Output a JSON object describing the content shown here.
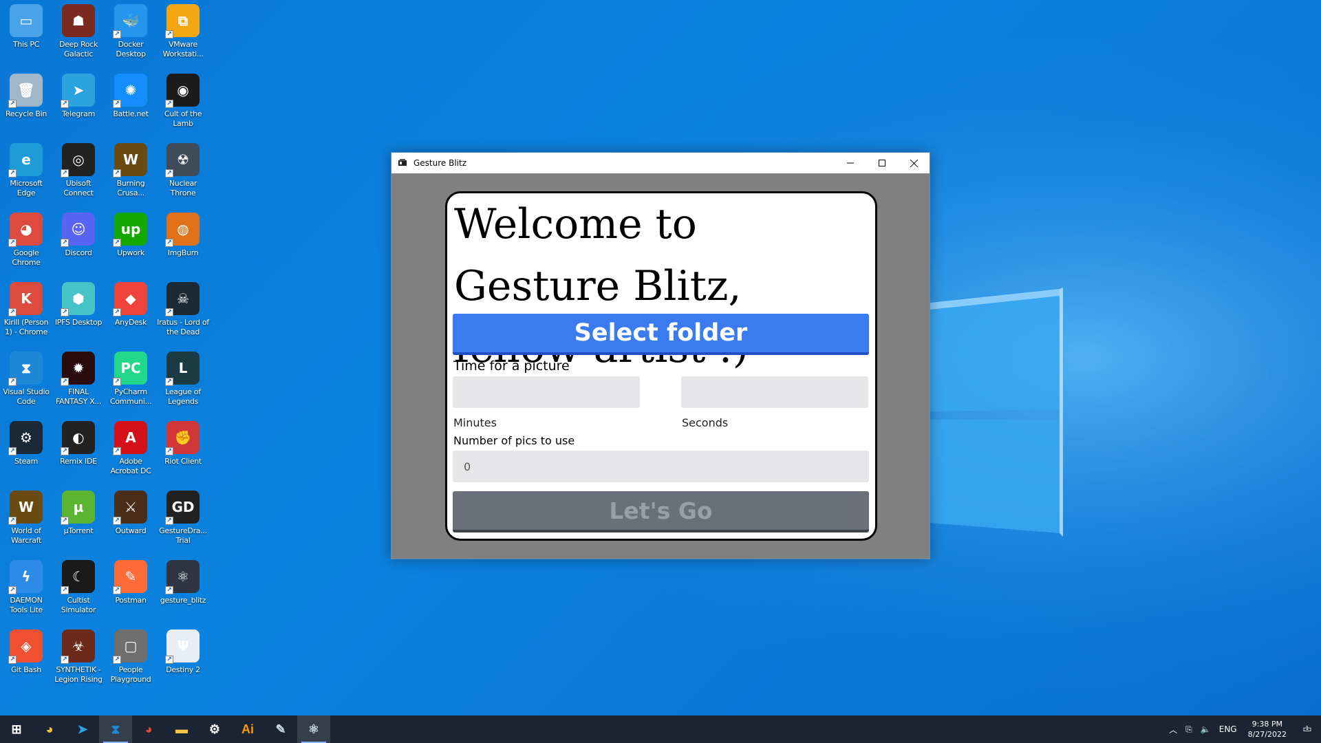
{
  "desktop": {
    "icons": [
      {
        "label": "This PC",
        "icon": "pc-icon",
        "color": "#4aa3e8",
        "glyph": "▭"
      },
      {
        "label": "Deep Rock Galactic",
        "icon": "deep-rock-icon",
        "color": "#7a2a20",
        "glyph": "☗"
      },
      {
        "label": "Docker Desktop",
        "icon": "docker-icon",
        "color": "#2496ed",
        "glyph": "🐳"
      },
      {
        "label": "VMware Workstati...",
        "icon": "vmware-icon",
        "color": "#f3a712",
        "glyph": "⧉"
      },
      {
        "label": "Recycle Bin",
        "icon": "recycle-bin-icon",
        "color": "#9fb7c9",
        "glyph": "🗑"
      },
      {
        "label": "Telegram",
        "icon": "telegram-icon",
        "color": "#2aa3df",
        "glyph": "➤"
      },
      {
        "label": "Battle.net",
        "icon": "battlenet-icon",
        "color": "#148eff",
        "glyph": "✺"
      },
      {
        "label": "Cult of the Lamb",
        "icon": "cult-of-the-lamb-icon",
        "color": "#1b1b1b",
        "glyph": "◉"
      },
      {
        "label": "Microsoft Edge",
        "icon": "edge-icon",
        "color": "#1d9bd7",
        "glyph": "e"
      },
      {
        "label": "Ubisoft Connect",
        "icon": "ubisoft-icon",
        "color": "#222222",
        "glyph": "◎"
      },
      {
        "label": "Burning Crusa...",
        "icon": "wow-burning-crusade-icon",
        "color": "#6a4b12",
        "glyph": "W"
      },
      {
        "label": "Nuclear Throne",
        "icon": "nuclear-throne-icon",
        "color": "#3f4a5a",
        "glyph": "☢"
      },
      {
        "label": "Google Chrome",
        "icon": "chrome-icon",
        "color": "#dd4b3e",
        "glyph": "◕"
      },
      {
        "label": "Discord",
        "icon": "discord-icon",
        "color": "#5865f2",
        "glyph": "☺"
      },
      {
        "label": "Upwork",
        "icon": "upwork-icon",
        "color": "#14a800",
        "glyph": "up"
      },
      {
        "label": "ImgBurn",
        "icon": "imgburn-icon",
        "color": "#e0701a",
        "glyph": "◍"
      },
      {
        "label": "Kirill (Person 1) - Chrome",
        "icon": "chrome-profile-icon",
        "color": "#dd4b3e",
        "glyph": "K"
      },
      {
        "label": "IPFS Desktop",
        "icon": "ipfs-icon",
        "color": "#46c3c6",
        "glyph": "⬢"
      },
      {
        "label": "AnyDesk",
        "icon": "anydesk-icon",
        "color": "#ef443b",
        "glyph": "◆"
      },
      {
        "label": "Iratus - Lord of the Dead",
        "icon": "iratus-icon",
        "color": "#1e2a33",
        "glyph": "☠"
      },
      {
        "label": "Visual Studio Code",
        "icon": "vscode-icon",
        "color": "#1e88d8",
        "glyph": "⧗"
      },
      {
        "label": "FINAL FANTASY X...",
        "icon": "ffxiv-icon",
        "color": "#2a0c0c",
        "glyph": "✹"
      },
      {
        "label": "PyCharm Communi...",
        "icon": "pycharm-icon",
        "color": "#21d789",
        "glyph": "PC"
      },
      {
        "label": "League of Legends",
        "icon": "league-icon",
        "color": "#1a3a44",
        "glyph": "L"
      },
      {
        "label": "Steam",
        "icon": "steam-icon",
        "color": "#1b2838",
        "glyph": "⚙"
      },
      {
        "label": "Remix IDE",
        "icon": "remix-icon",
        "color": "#222222",
        "glyph": "◐"
      },
      {
        "label": "Adobe Acrobat DC",
        "icon": "acrobat-icon",
        "color": "#d4111a",
        "glyph": "A"
      },
      {
        "label": "Riot Client",
        "icon": "riot-icon",
        "color": "#d13639",
        "glyph": "✊"
      },
      {
        "label": "World of Warcraft",
        "icon": "wow-icon",
        "color": "#6a4b12",
        "glyph": "W"
      },
      {
        "label": "µTorrent",
        "icon": "utorrent-icon",
        "color": "#5cb531",
        "glyph": "µ"
      },
      {
        "label": "Outward",
        "icon": "outward-icon",
        "color": "#4a2e1a",
        "glyph": "⚔"
      },
      {
        "label": "GestureDra... Trial",
        "icon": "gesturedrawing-icon",
        "color": "#222222",
        "glyph": "GD"
      },
      {
        "label": "DAEMON Tools Lite",
        "icon": "daemon-tools-icon",
        "color": "#2b8be6",
        "glyph": "ϟ"
      },
      {
        "label": "Cultist Simulator",
        "icon": "cultist-simulator-icon",
        "color": "#1a1a1a",
        "glyph": "☾"
      },
      {
        "label": "Postman",
        "icon": "postman-icon",
        "color": "#ff6c37",
        "glyph": "✎"
      },
      {
        "label": "gesture_blitz",
        "icon": "electron-app-icon",
        "color": "#2f3542",
        "glyph": "⚛"
      },
      {
        "label": "Git Bash",
        "icon": "git-bash-icon",
        "color": "#f05032",
        "glyph": "◈"
      },
      {
        "label": "SYNTHETIK - Legion Rising",
        "icon": "synthetik-icon",
        "color": "#6b2a1a",
        "glyph": "☣"
      },
      {
        "label": "People Playground",
        "icon": "people-playground-icon",
        "color": "#6f6f6f",
        "glyph": "▢"
      },
      {
        "label": "Destiny 2",
        "icon": "destiny-icon",
        "color": "#e8eef5",
        "glyph": "Ψ"
      }
    ]
  },
  "window": {
    "title": "Gesture Blitz",
    "minimize": "─",
    "maximize": "☐",
    "close": "✕"
  },
  "app": {
    "welcome": "Welcome to Gesture Blitz, fellow artist :)",
    "select_folder": "Select folder",
    "time_label": "Time for a picture",
    "minutes_value": "",
    "seconds_value": "",
    "minutes_label": "Minutes",
    "seconds_label": "Seconds",
    "pics_label": "Number of pics to use",
    "pics_value": "0",
    "go_label": "Let's Go"
  },
  "taskbar": {
    "items": [
      {
        "name": "start-icon",
        "glyph": "⊞",
        "color": "#ffffff"
      },
      {
        "name": "chrome-taskbar-icon",
        "glyph": "◕",
        "color": "#f2c230"
      },
      {
        "name": "telegram-taskbar-icon",
        "glyph": "➤",
        "color": "#2aa3df"
      },
      {
        "name": "vscode-taskbar-icon",
        "glyph": "⧗",
        "color": "#1e88d8"
      },
      {
        "name": "chrome-profile-taskbar-icon",
        "glyph": "◕",
        "color": "#dd4b3e"
      },
      {
        "name": "file-explorer-icon",
        "glyph": "▬",
        "color": "#f6c445"
      },
      {
        "name": "settings-icon",
        "glyph": "⚙",
        "color": "#ffffff"
      },
      {
        "name": "illustrator-icon",
        "glyph": "Ai",
        "color": "#ff9a00"
      },
      {
        "name": "paint-app-icon",
        "glyph": "✎",
        "color": "#c9d6e6"
      },
      {
        "name": "electron-taskbar-icon",
        "glyph": "⚛",
        "color": "#c9d6e6"
      }
    ],
    "lang": "ENG",
    "time": "9:38 PM",
    "date": "8/27/2022",
    "notifications": "1"
  }
}
